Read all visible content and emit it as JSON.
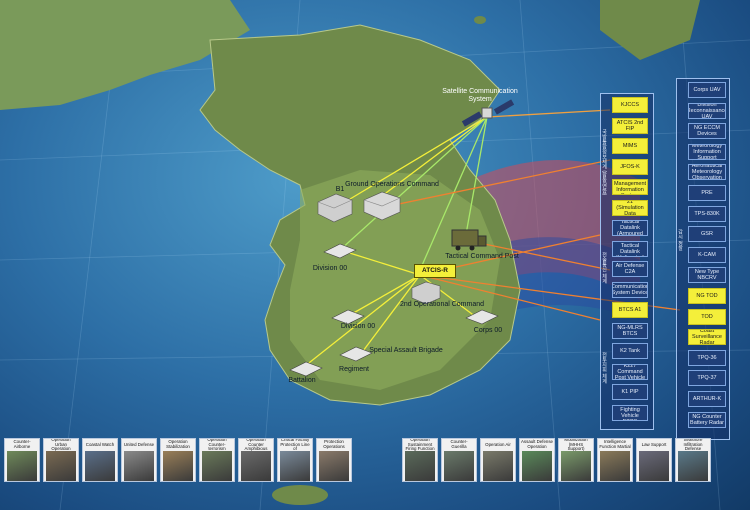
{
  "satellite": {
    "label": "Satellite Communication System"
  },
  "map_labels": {
    "b1": "B1",
    "ground_ops": "Ground Operations Command",
    "tactical_cp": "Tactical Command Post",
    "division": "Division 00",
    "atcis": "ATCIS-R",
    "second_ops": "2nd Operational Command",
    "division2": "Division 00",
    "corps": "Corps 00",
    "special_assault": "Special Assault Brigade",
    "regiment": "Regiment",
    "battalion": "Battalion"
  },
  "panel": {
    "col1_tabs": [
      "국방통합정보체계 (합동/연합)",
      "전술통신 체계",
      "전투지휘 체계"
    ],
    "col1": [
      {
        "label": "KJCCS",
        "y": true
      },
      {
        "label": "ATCIS 2nd FIP",
        "y": true
      },
      {
        "label": "MIMS",
        "y": true
      },
      {
        "label": "JFOS-K",
        "y": true
      },
      {
        "label": "Resource Management Information System",
        "y": true
      },
      {
        "label": "Jamsoung 21 (Simulation Data System)",
        "y": true
      },
      {
        "label": "Ground Tactical Datalink (Armoured Vehicle)",
        "y": false
      },
      {
        "label": "Ground Tactical Datalink (Helicopter)",
        "y": false
      },
      {
        "label": "Air Defense C2A",
        "y": false
      },
      {
        "label": "Communication System Device",
        "y": false
      },
      {
        "label": "BTCS A1",
        "y": true
      },
      {
        "label": "NG-MLRS BTCS",
        "y": false
      },
      {
        "label": "K2 Tank",
        "y": false
      },
      {
        "label": "K227 Command Post Vehicle",
        "y": false
      },
      {
        "label": "K1 PIP",
        "y": false
      },
      {
        "label": "K21 Infantry Fighting Vehicle BTCS",
        "y": false
      }
    ],
    "col2_tab": "감시 정찰",
    "col2": [
      {
        "label": "Corps UAV",
        "y": false
      },
      {
        "label": "Division Reconnaissance UAV",
        "y": false
      },
      {
        "label": "NG ECCM Devices",
        "y": false
      },
      {
        "label": "Military Meteorology Information Support System",
        "y": false
      },
      {
        "label": "Mobile Aeronautical Meteorology Observation Device",
        "y": false
      },
      {
        "label": "PRE",
        "y": false
      },
      {
        "label": "TPS-830K",
        "y": false
      },
      {
        "label": "GSR",
        "y": false
      },
      {
        "label": "K-CAM",
        "y": false
      },
      {
        "label": "New Type NBCRV",
        "y": false
      },
      {
        "label": "NG TOD",
        "y": true
      },
      {
        "label": "TOD",
        "y": true
      },
      {
        "label": "Coast Surveillance Radar",
        "y": true
      },
      {
        "label": "TPQ-36",
        "y": false
      },
      {
        "label": "TPQ-37",
        "y": false
      },
      {
        "label": "ARTHUR-K",
        "y": false
      },
      {
        "label": "NG Counter Battery Radar",
        "y": false
      }
    ]
  },
  "ops_left": [
    {
      "label": "Counter-Airborne",
      "color": "#6f8a5a"
    },
    {
      "label": "Operation Urban Operation",
      "color": "#7a6a52"
    },
    {
      "label": "Coastal Watch",
      "color": "#5a6f8a"
    },
    {
      "label": "United Defense",
      "color": "#8a8a8a"
    },
    {
      "label": "Operation Stabilization",
      "color": "#9a7f58"
    },
    {
      "label": "Operation Counter-terrorism",
      "color": "#6a7a5a"
    },
    {
      "label": "Operation Counter Amphibious",
      "color": "#6a6a6a"
    },
    {
      "label": "Operation Critical Facility Protection Line of Communications",
      "color": "#7a8a9a"
    },
    {
      "label": "Protection Operations",
      "color": "#8a7a6a"
    }
  ],
  "ops_right": [
    {
      "label": "Operation Sustainment Firing Function",
      "color": "#5a6a5a"
    },
    {
      "label": "Counter-Guerilla",
      "color": "#6a7a6a"
    },
    {
      "label": "Operation Air",
      "color": "#7a7a6a"
    },
    {
      "label": "Assault Defense Operation",
      "color": "#5a8a5a"
    },
    {
      "label": "Mobilization (MHHS Support)",
      "color": "#7a9a6a"
    },
    {
      "label": "Intelligence Function Martial",
      "color": "#8a7a5a"
    },
    {
      "label": "Law Support",
      "color": "#6a6a7a"
    },
    {
      "label": "Seashore Infiltration Defense",
      "color": "#5a7a8a"
    }
  ]
}
